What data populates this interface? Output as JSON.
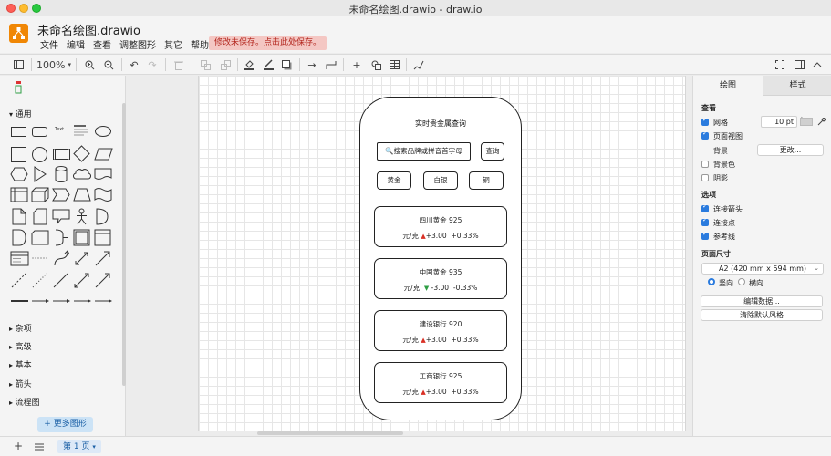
{
  "window": {
    "title": "未命名绘图.drawio - draw.io"
  },
  "app": {
    "doc_title": "未命名绘图.drawio",
    "menu": [
      "文件",
      "编辑",
      "查看",
      "调整图形",
      "其它",
      "帮助"
    ],
    "unsaved_notice": "修改未保存。点击此处保存。"
  },
  "toolbar": {
    "zoom": "100%"
  },
  "left_panel": {
    "section_general": "通用",
    "sections": [
      "杂项",
      "高级",
      "基本",
      "箭头",
      "流程图"
    ],
    "more_shapes": "+ 更多图形"
  },
  "diagram": {
    "title": "实时贵金属查询",
    "search_placeholder": "🔍搜索品牌或拼音首字母",
    "query_button": "查询",
    "filters": [
      "黄金",
      "白银",
      "铜"
    ],
    "cards": [
      {
        "name": "四川黄金  925",
        "unit": "元/克",
        "direction": "up",
        "change": "+3.00",
        "percent": "+0.33%"
      },
      {
        "name": "中国黄金  935",
        "unit": "元/克",
        "direction": "down",
        "change": "-3.00",
        "percent": "-0.33%"
      },
      {
        "name": "建设银行  920",
        "unit": "元/克",
        "direction": "up",
        "change": "+3.00",
        "percent": "+0.33%"
      },
      {
        "name": "工商银行  925",
        "unit": "元/克",
        "direction": "up",
        "change": "+3.00",
        "percent": "+0.33%"
      }
    ]
  },
  "right_panel": {
    "tabs": [
      "绘图",
      "样式"
    ],
    "view_heading": "查看",
    "grid_label": "网格",
    "grid_size": "10 pt",
    "page_view_label": "页面视图",
    "background_label": "背景",
    "change_button": "更改...",
    "bg_color_label": "背景色",
    "shadow_label": "阴影",
    "options_heading": "选项",
    "connection_arrows_label": "连接箭头",
    "connection_points_label": "连接点",
    "guides_label": "参考线",
    "page_size_heading": "页面尺寸",
    "page_size_value": "A2 (420 mm x 594 mm)",
    "portrait_label": "竖向",
    "landscape_label": "横向",
    "edit_data_button": "编辑数据...",
    "clear_style_button": "清除默认风格",
    "options": {
      "grid": true,
      "page_view": true,
      "background_color": false,
      "shadow": false,
      "connection_arrows": true,
      "connection_points": true,
      "guides": true,
      "portrait": true
    }
  },
  "bottom": {
    "page_tab": "第 1 页"
  },
  "colors": {
    "accent": "#2a7bde",
    "logo": "#f08705",
    "up": "#d93025",
    "down": "#2e9e44"
  }
}
